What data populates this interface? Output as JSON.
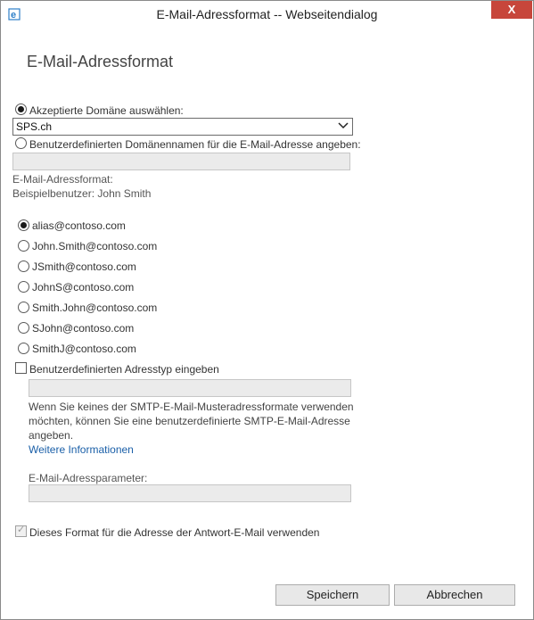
{
  "window": {
    "title": "E-Mail-Adressformat -- Webseitendialog",
    "close_label": "X"
  },
  "dialog": {
    "heading": "E-Mail-Adressformat",
    "domain_select": {
      "accepted_label": "Akzeptierte Domäne auswählen:",
      "selected_value": "SPS.ch",
      "custom_label": "Benutzerdefinierten Domänennamen für die E-Mail-Adresse angeben:"
    },
    "format_label": "E-Mail-Adressformat:",
    "sample_user": "Beispielbenutzer: John Smith",
    "formats": [
      "alias@contoso.com",
      "John.Smith@contoso.com",
      "JSmith@contoso.com",
      "JohnS@contoso.com",
      "Smith.John@contoso.com",
      "SJohn@contoso.com",
      "SmithJ@contoso.com"
    ],
    "custom_type_label": "Benutzerdefinierten Adresstyp eingeben",
    "custom_info": "Wenn Sie keines der SMTP-E-Mail-Musteradressformate verwenden möchten, können Sie eine benutzerdefinierte SMTP-E-Mail-Adresse angeben.",
    "more_info_link": "Weitere Informationen",
    "param_label": "E-Mail-Adressparameter:",
    "reply_label": "Dieses Format für die Adresse der Antwort-E-Mail verwenden"
  },
  "buttons": {
    "save": "Speichern",
    "cancel": "Abbrechen"
  }
}
